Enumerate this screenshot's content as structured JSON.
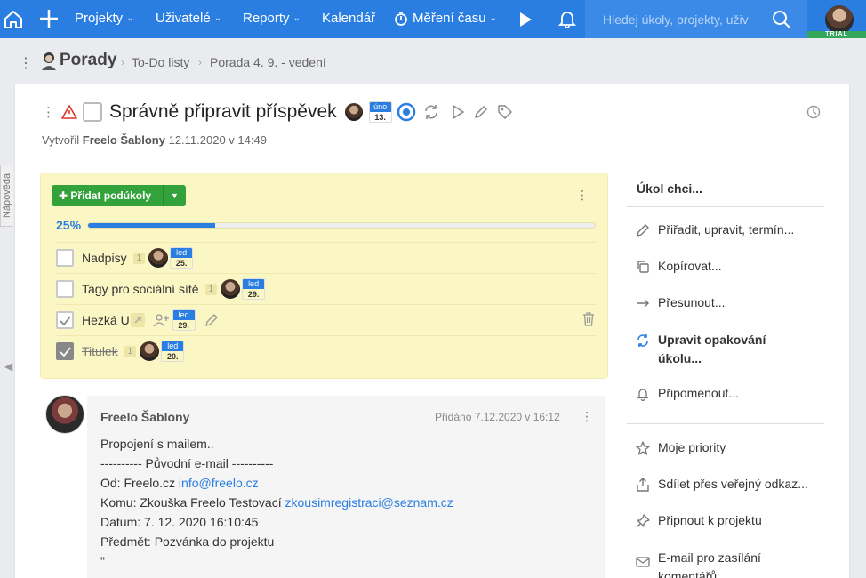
{
  "topbar": {
    "nav": [
      "Projekty",
      "Uživatelé",
      "Reporty",
      "Kalendář",
      "Měření času"
    ],
    "search_placeholder": "Hledej úkoly, projekty, uživ",
    "trial_badge": "TRIAL"
  },
  "breadcrumb": {
    "project": "Porady",
    "list": "To-Do listy",
    "task": "Porada 4. 9. - vedení"
  },
  "side_tab": "Nápověda",
  "task": {
    "title": "Správně připravit příspěvek",
    "due_month": "úno",
    "due_day": "13.",
    "created_prefix": "Vytvořil",
    "created_by": "Freelo Šablony",
    "created_at": "12.11.2020 v 14:49"
  },
  "subtasks": {
    "add_label": "Přidat podúkoly",
    "progress_text": "25%",
    "progress": 0.25,
    "items": [
      {
        "label": "Nadpisy",
        "count": "1",
        "month": "led",
        "day": "25.",
        "done": false
      },
      {
        "label": "Tagy pro sociální sítě",
        "count": "1",
        "month": "led",
        "day": "29.",
        "done": false
      },
      {
        "label": "Hezká U",
        "count": "",
        "month": "led",
        "day": "29.",
        "done": true
      },
      {
        "label": "Titulek",
        "count": "1",
        "month": "led",
        "day": "20.",
        "done": true
      }
    ]
  },
  "comment": {
    "author": "Freelo Šablony",
    "added": "Přidáno 7.12.2020 v 16:12",
    "line1": "Propojení s mailem..",
    "line2": "---------- Původní e-mail ----------",
    "from_prefix": "Od: Freelo.cz ",
    "from_email": "info@freelo.cz",
    "to_prefix": "Komu: Zkouška Freelo Testovací ",
    "to_email": "zkousimregistraci@seznam.cz",
    "date": "Datum: 7. 12. 2020 16:10:45",
    "subject": "Předmět: Pozvánka do projektu",
    "quote": "\""
  },
  "actions": {
    "header": "Úkol chci...",
    "group1": [
      {
        "label": "Přiřadit, upravit, termín...",
        "icon": "pencil-icon"
      },
      {
        "label": "Kopírovat...",
        "icon": "copy-icon"
      },
      {
        "label": "Přesunout...",
        "icon": "arrow-right-icon"
      },
      {
        "label": "Upravit opakování úkolu...",
        "icon": "repeat-icon"
      },
      {
        "label": "Připomenout...",
        "icon": "bell-icon"
      }
    ],
    "group2": [
      {
        "label": "Moje priority",
        "icon": "star-icon"
      },
      {
        "label": "Sdílet přes veřejný odkaz...",
        "icon": "share-icon"
      },
      {
        "label": "Připnout k projektu",
        "icon": "pin-icon"
      },
      {
        "label": "E-mail pro zasílání komentářů...",
        "icon": "mail-icon"
      }
    ]
  },
  "colors": {
    "brand": "#2a7de1",
    "green": "#33a23a",
    "panel": "#fbf7c4"
  }
}
